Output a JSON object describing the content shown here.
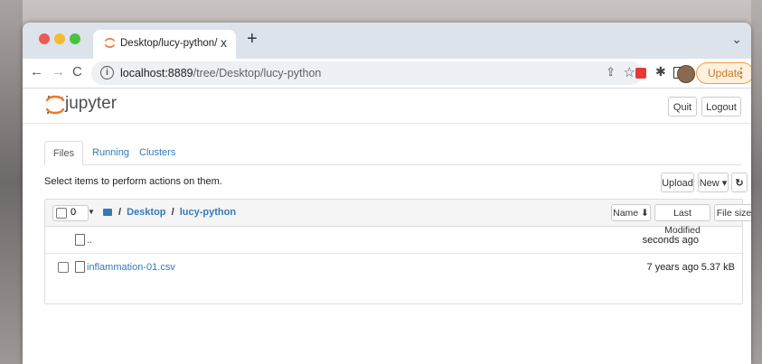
{
  "browser": {
    "tab_title": "Desktop/lucy-python/",
    "tab_close": "x",
    "new_tab": "+",
    "tab_menu": "⌄",
    "url_host": "localhost:8889",
    "url_path": "/tree/Desktop/lucy-python",
    "update_label": "Update",
    "update_dots": "⋮"
  },
  "jupyter": {
    "brand": "jupyter",
    "quit_label": "Quit",
    "logout_label": "Logout",
    "tabs": [
      "Files",
      "Running",
      "Clusters"
    ],
    "select_hint": "Select items to perform actions on them.",
    "upload_label": "Upload",
    "new_label": "New ▾",
    "refresh_icon": "↻",
    "selected_count": "0",
    "breadcrumb": [
      "Desktop",
      "lucy-python"
    ],
    "breadcrumb_root": "/",
    "breadcrumb_sep": "/",
    "headers": {
      "name": "Name ⬇",
      "last_modified": "Last Modified",
      "file_size": "File size"
    },
    "rows": [
      {
        "name": "..",
        "modified": "seconds ago",
        "size": ""
      },
      {
        "name": "inflammation-01.csv",
        "modified": "7 years ago",
        "size": "5.37 kB"
      }
    ]
  },
  "colors": {
    "link": "#337ab7",
    "jupyter_orange": "#f37726",
    "update_accent": "#e9a23b"
  }
}
